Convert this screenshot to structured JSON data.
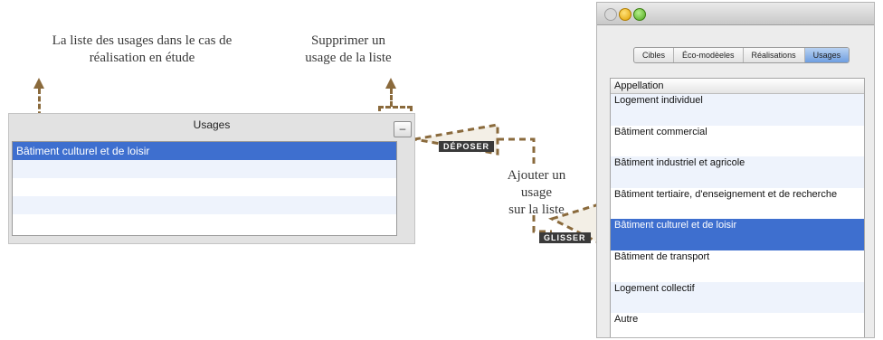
{
  "annotations": {
    "list_caption_line1": "La liste des usages dans le cas de",
    "list_caption_line2": "réalisation en étude",
    "remove_caption_line1": "Supprimer un",
    "remove_caption_line2": "usage de la liste",
    "add_caption_line1": "Ajouter un",
    "add_caption_line2": "usage",
    "add_caption_line3": "sur la  liste",
    "drop_tag": "DÉPOSER",
    "drag_tag": "GLISSER"
  },
  "usages_panel": {
    "title": "Usages",
    "remove_button": "–",
    "rows": [
      "Bâtiment culturel et de loisir",
      "",
      "",
      "",
      ""
    ]
  },
  "window": {
    "tabs": [
      {
        "label": "Cibles",
        "active": false
      },
      {
        "label": "Éco-modèeles",
        "active": false
      },
      {
        "label": "Réalisations",
        "active": false
      },
      {
        "label": "Usages",
        "active": true
      }
    ],
    "column_header": "Appellation",
    "rows": [
      "Logement individuel",
      "Bâtiment commercial",
      "Bâtiment industriel et agricole",
      "Bâtiment tertiaire, d'enseignement et de recherche",
      "Bâtiment culturel et de loisir",
      "Bâtiment de transport",
      "Logement collectif",
      "Autre"
    ],
    "selected_row": "Bâtiment culturel et de loisir"
  },
  "colors": {
    "selection": "#3e6fcf",
    "annotation_dash": "#8a6a3c"
  }
}
